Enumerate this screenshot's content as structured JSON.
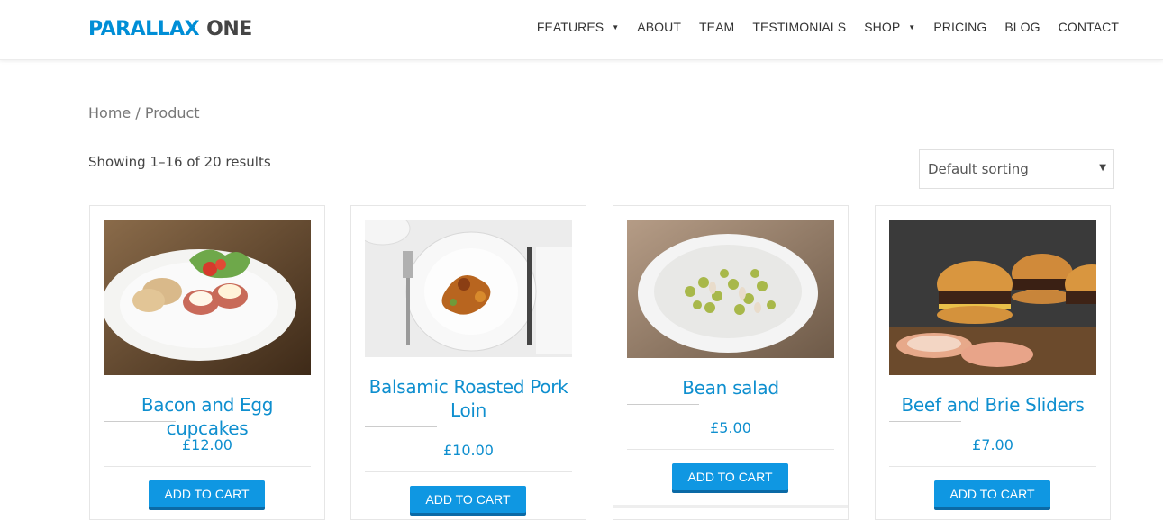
{
  "brand": {
    "part1": "PARALLAX",
    "part2": "ONE"
  },
  "nav": [
    {
      "label": "FEATURES",
      "dropdown": true
    },
    {
      "label": "ABOUT",
      "dropdown": false
    },
    {
      "label": "TEAM",
      "dropdown": false
    },
    {
      "label": "TESTIMONIALS",
      "dropdown": false
    },
    {
      "label": "SHOP",
      "dropdown": true
    },
    {
      "label": "PRICING",
      "dropdown": false
    },
    {
      "label": "BLOG",
      "dropdown": false
    },
    {
      "label": "CONTACT",
      "dropdown": false
    }
  ],
  "breadcrumb": {
    "home": "Home",
    "separator": "/",
    "current": "Product"
  },
  "result_count": "Showing 1–16 of 20 results",
  "sorting": {
    "selected": "Default sorting"
  },
  "products": [
    {
      "title": "Bacon and Egg cupcakes",
      "price": "£12.00",
      "button": "ADD TO CART"
    },
    {
      "title": "Balsamic Roasted Pork Loin",
      "price": "£10.00",
      "button": "ADD TO CART"
    },
    {
      "title": "Bean salad",
      "price": "£5.00",
      "button": "ADD TO CART"
    },
    {
      "title": "Beef and Brie Sliders",
      "price": "£7.00",
      "button": "ADD TO CART"
    }
  ],
  "colors": {
    "accent": "#0f8fcf",
    "button": "#0f97e2",
    "logo_blue": "#008ed6"
  }
}
